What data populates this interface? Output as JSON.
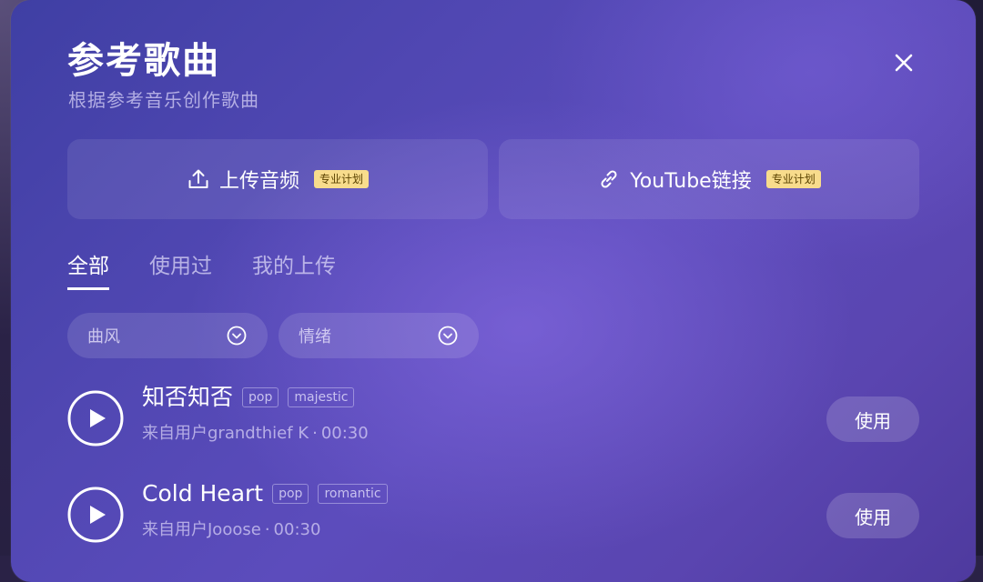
{
  "modal": {
    "title": "参考歌曲",
    "subtitle": "根据参考音乐创作歌曲"
  },
  "upload": {
    "audio_label": "上传音频",
    "audio_badge": "专业计划",
    "youtube_label": "YouTube链接",
    "youtube_badge": "专业计划"
  },
  "tabs": [
    {
      "label": "全部",
      "active": true
    },
    {
      "label": "使用过",
      "active": false
    },
    {
      "label": "我的上传",
      "active": false
    }
  ],
  "filters": [
    {
      "label": "曲风"
    },
    {
      "label": "情绪"
    }
  ],
  "songs": [
    {
      "title": "知否知否",
      "tags": [
        "pop",
        "majestic"
      ],
      "source": "来自用户grandthief K",
      "separator": "·",
      "duration": "00:30",
      "button": "使用"
    },
    {
      "title": "Cold Heart",
      "tags": [
        "pop",
        "romantic"
      ],
      "source": "来自用户Jooose",
      "separator": "·",
      "duration": "00:30",
      "button": "使用"
    }
  ],
  "colors": {
    "badge_bg": "#f8dc8c",
    "text_primary": "#ffffff"
  }
}
